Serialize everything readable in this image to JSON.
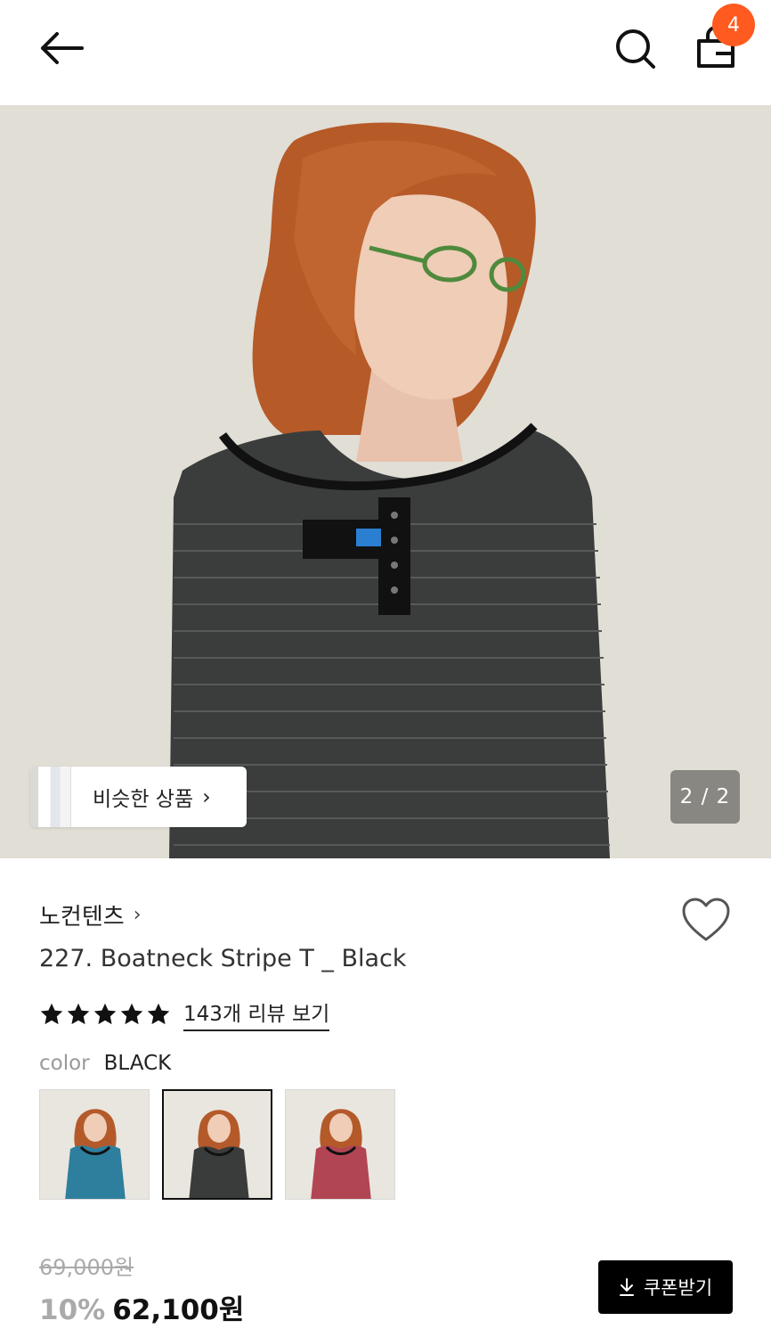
{
  "header": {
    "back_icon": "arrow-left-icon",
    "search_icon": "search-icon",
    "cart_icon": "shopping-bag-icon",
    "cart_count": "4",
    "badge_color": "#ff5a1f"
  },
  "gallery": {
    "similar_label": "비슷한 상품",
    "page_indicator": "2 / 2"
  },
  "product": {
    "brand": "노컨텐츠",
    "title": "227. Boatneck Stripe T _ Black",
    "rating": 5,
    "review_link": "143개 리뷰 보기",
    "color_label": "color",
    "color_value": "BLACK",
    "swatches": [
      {
        "color": "#2e7f9e",
        "selected": false
      },
      {
        "color": "#3a3c3b",
        "selected": true
      },
      {
        "color": "#b24553",
        "selected": false
      }
    ]
  },
  "price": {
    "original": "69,000원",
    "discount": "10%",
    "sale": "62,100원"
  },
  "coupon": {
    "label": "쿠폰받기",
    "icon": "download-icon"
  }
}
